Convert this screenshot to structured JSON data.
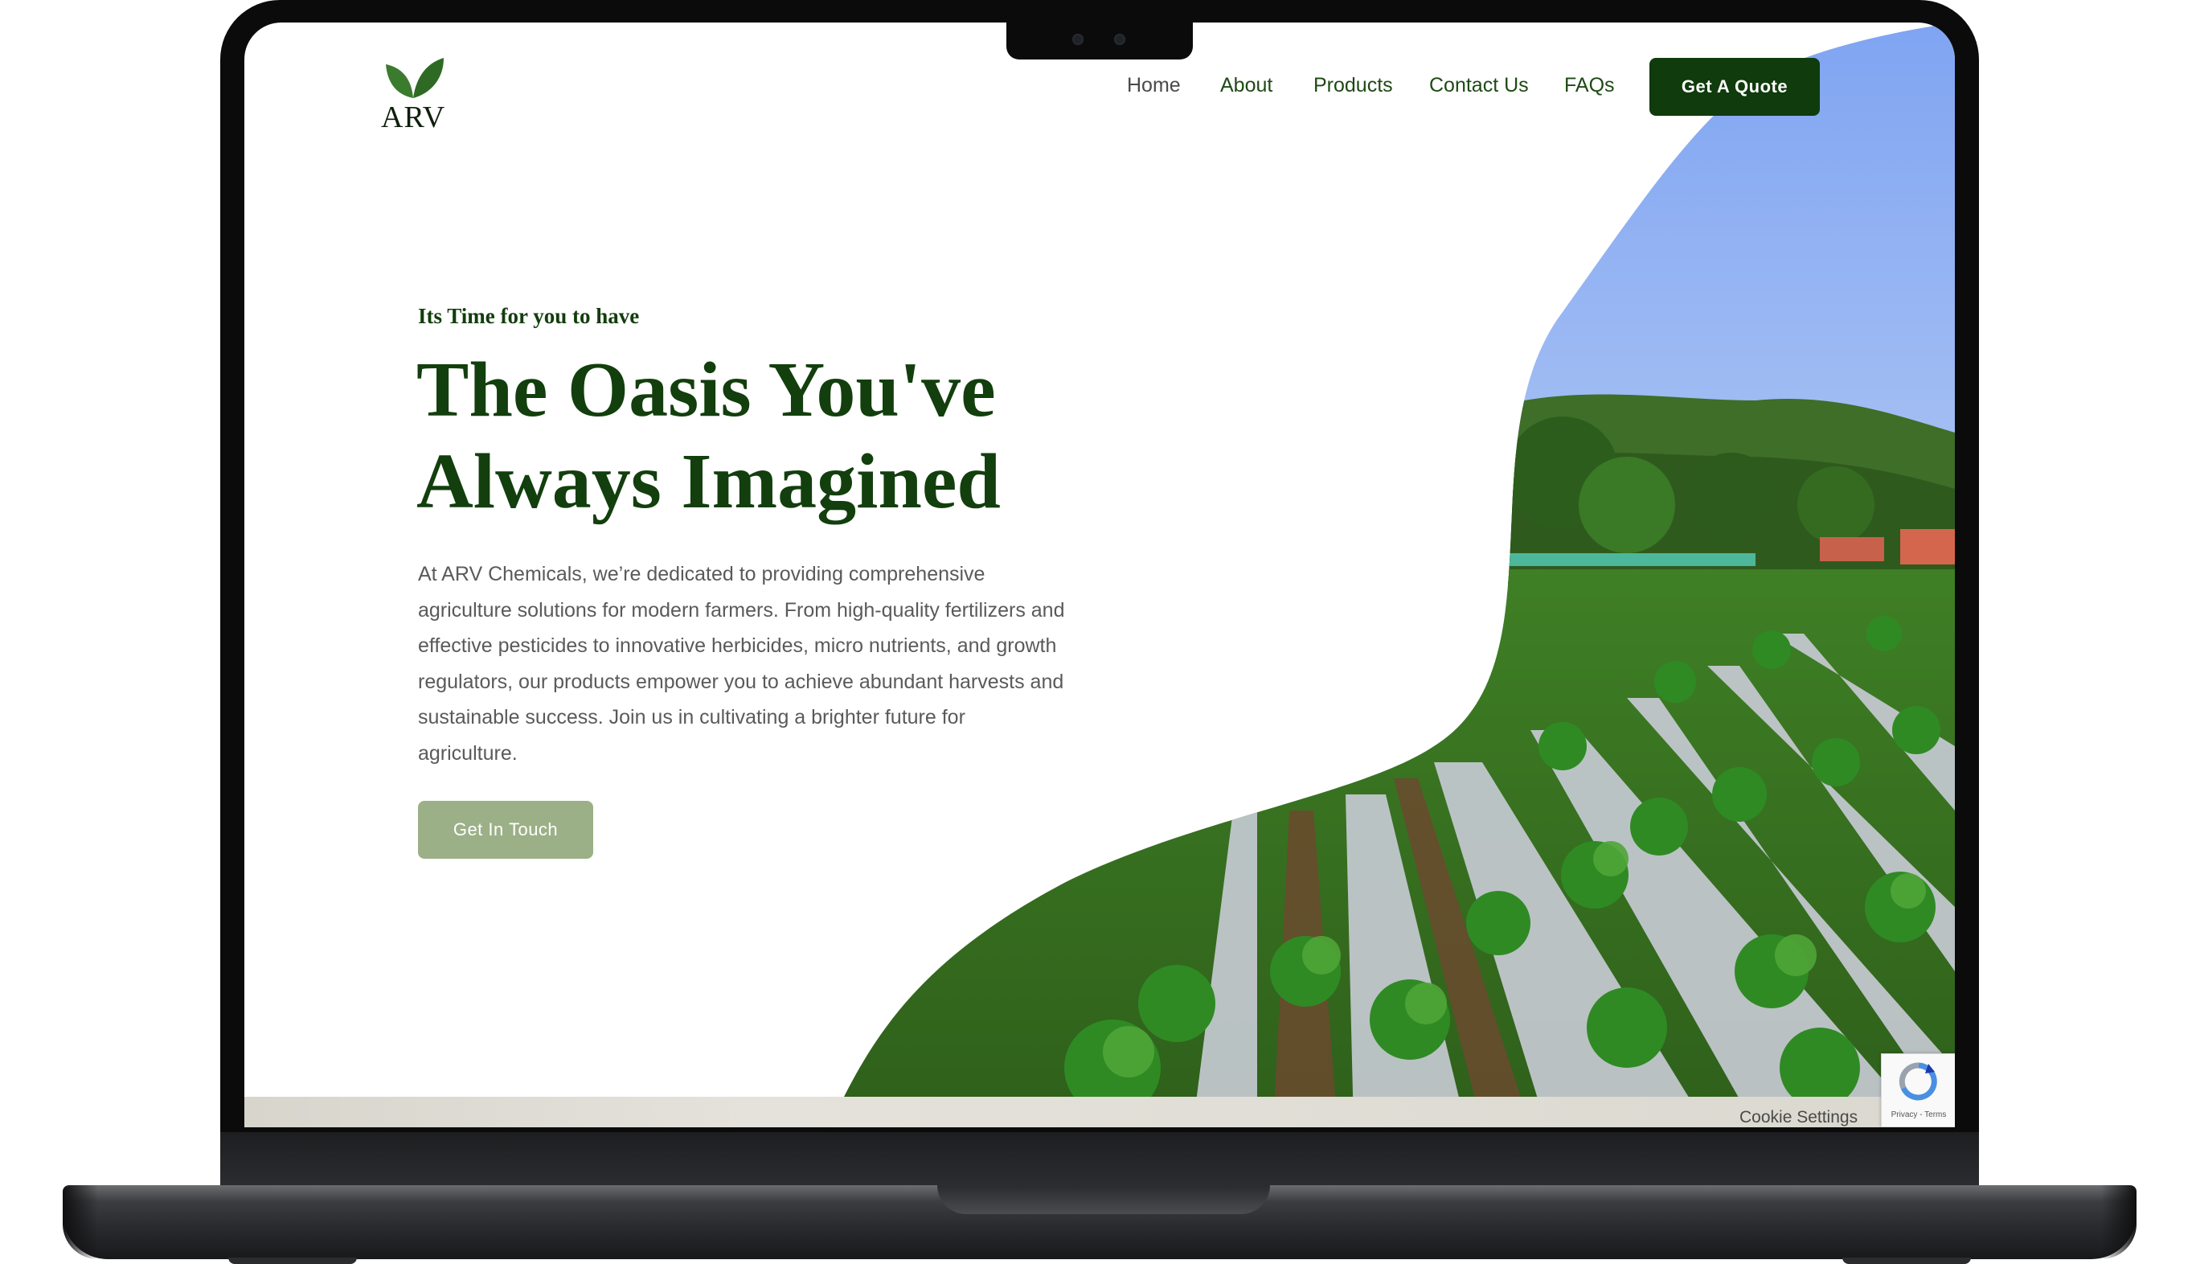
{
  "header": {
    "logo_text": "ARV",
    "nav": [
      {
        "label": "Home"
      },
      {
        "label": "About"
      },
      {
        "label": "Products"
      },
      {
        "label": "Contact Us"
      },
      {
        "label": "FAQs"
      }
    ],
    "cta_label": "Get A Quote"
  },
  "hero": {
    "eyebrow": "Its Time for you to have",
    "headline_line1": "The Oasis You've",
    "headline_line2": "Always Imagined",
    "body": "At ARV Chemicals, we’re dedicated to providing comprehensive agriculture solutions for modern farmers. From high-quality fertilizers and effective pesticides to innovative herbicides, micro nutrients, and growth regulators, our products empower you to achieve abundant harvests and sustainable success. Join us in cultivating a brighter future for agriculture.",
    "button_label": "Get In Touch"
  },
  "footer": {
    "cookie_settings": "Cookie Settings",
    "recaptcha_links": "Privacy - Terms"
  },
  "colors": {
    "brand_dark_green": "#103b0c",
    "button_sage": "#9cb087",
    "nav_green": "#1e4a14"
  },
  "icons": [
    "leaf-logo-icon",
    "recaptcha-icon"
  ]
}
